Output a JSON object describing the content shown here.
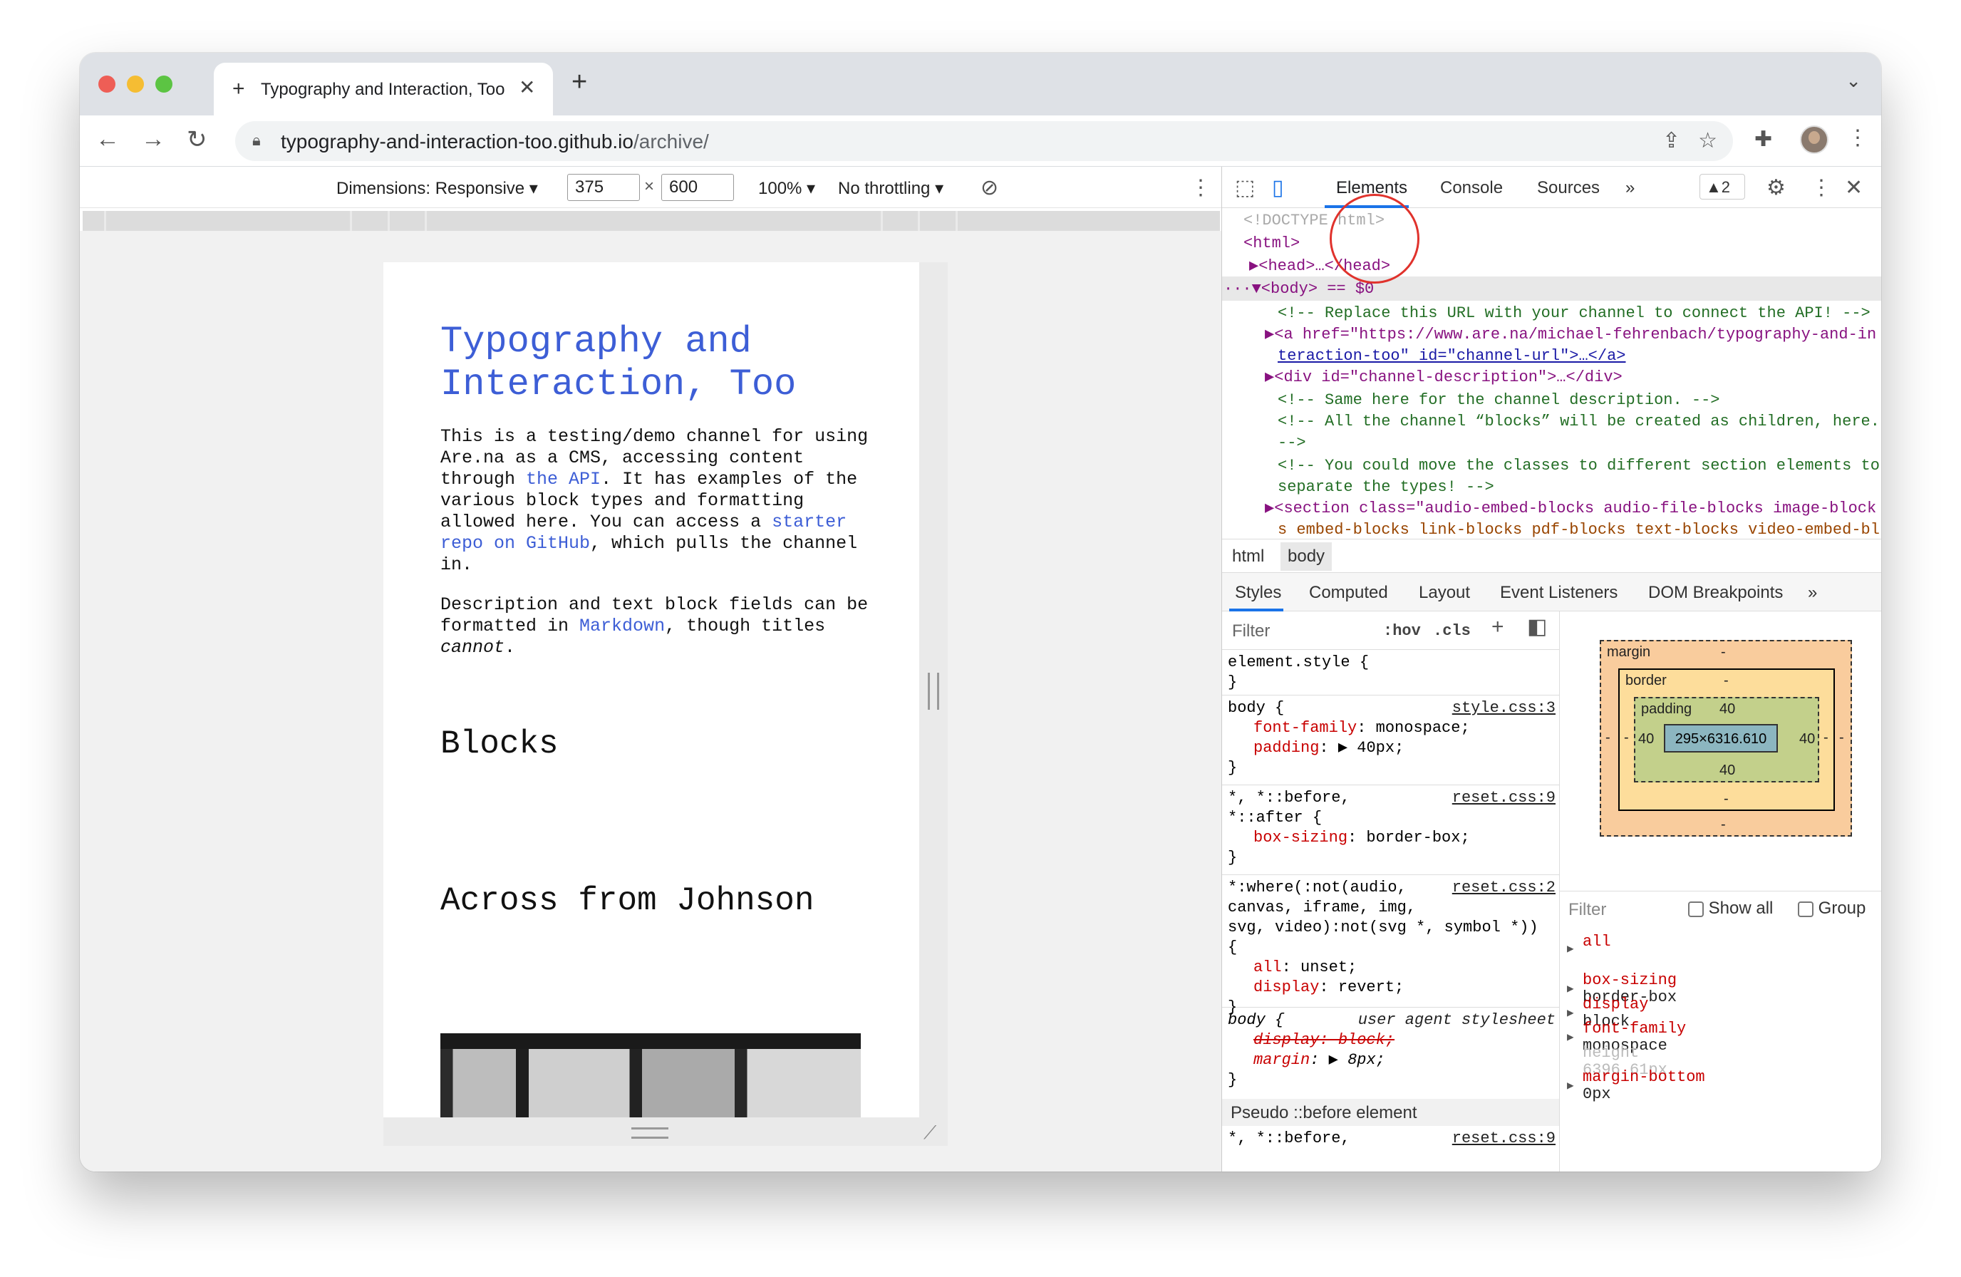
{
  "browser": {
    "tab_title": "Typography and Interaction, Too",
    "url_host": "typography-and-interaction-too.github.io",
    "url_path": "/archive/"
  },
  "device_toolbar": {
    "dimensions_label": "Dimensions: Responsive ▾",
    "width": "375",
    "height": "600",
    "times": "×",
    "zoom": "100% ▾",
    "throttling": "No throttling ▾"
  },
  "page": {
    "title": "Typography and Interaction, Too",
    "intro": [
      "This is a testing/demo channel for using Are.na as a CMS, accessing content through ",
      "the API",
      ". It has examples of the various block types and formatting allowed here. You can access a ",
      "starter repo on GitHub",
      ", which pulls the channel in."
    ],
    "desc": [
      "Description and text block fields can be formatted in ",
      "Markdown",
      ", though titles ",
      "cannot",
      "."
    ],
    "blocks_heading": "Blocks",
    "block_title": "Across from Johnson"
  },
  "devtools": {
    "tabs": [
      "Elements",
      "Console",
      "Sources",
      "»"
    ],
    "warnings": "▲2",
    "dom": [
      "<!DOCTYPE html>",
      "<html>",
      "▶<head>…</head>",
      "···▼<body> == $0",
      "<!-- Replace this URL with your channel to connect the API! -->",
      "▶<a href=\"https://www.are.na/michael-fehrenbach/typography-and-in",
      "teraction-too\" id=\"channel-url\">…</a>",
      "▶<div id=\"channel-description\">…</div>",
      "<!-- Same here for the channel description. -->",
      "<!-- All the channel “blocks” will be created as children, here.",
      "-->",
      "<!-- You could move the classes to different section elements to",
      "separate the types! -->",
      "▶<section class=\"audio-embed-blocks audio-file-blocks image-block",
      "s embed-blocks link-blocks pdf-blocks text-blocks video-embed-bl"
    ],
    "breadcrumbs": [
      "html",
      "body"
    ],
    "style_tabs": [
      "Styles",
      "Computed",
      "Layout",
      "Event Listeners",
      "DOM Breakpoints",
      "»"
    ],
    "filter_placeholder": "Filter",
    "hov": ":hov",
    "cls": ".cls",
    "rules": {
      "r1": [
        "element.style {",
        "}"
      ],
      "r2": {
        "sel": "body {",
        "src": "style.css:3",
        "l1p": "font-family",
        "l1v": ": monospace;",
        "l2p": "padding",
        "l2v": ": ▶ 40px;",
        "end": "}"
      },
      "r3": {
        "sel1": "*, *::before,",
        "sel2": "*::after {",
        "src": "reset.css:9",
        "p": "box-sizing",
        "v": ": border-box;",
        "end": "}"
      },
      "r4": {
        "sel1": "*:where(:not(audio,",
        "sel2": "canvas, iframe, img,",
        "sel3": "svg, video):not(svg *, symbol *))",
        "sel4": "{",
        "src": "reset.css:2",
        "p1": "all",
        "v1": ": unset;",
        "p2": "display",
        "v2": ": revert;",
        "end": "}"
      },
      "r5": {
        "sel": "body {",
        "src": "user agent stylesheet",
        "p1": "display: block;",
        "p2": "margin",
        "v2": ": ▶ 8px;",
        "end": "}"
      },
      "pseudo": "Pseudo ::before element",
      "r6": {
        "sel": "*, *::before,",
        "src": "reset.css:9"
      }
    },
    "box_model": {
      "margin_label": "margin",
      "margin": "-",
      "border_label": "border",
      "border": "-",
      "padding_label": "padding",
      "padding": "40",
      "content": "295×6316.610"
    },
    "computed": {
      "filter": "Filter",
      "show_all": "Show all",
      "group": "Group",
      "items": [
        {
          "name": "all",
          "value": ""
        },
        {
          "name": "box-sizing",
          "value": "border-box"
        },
        {
          "name": "display",
          "value": "block"
        },
        {
          "name": "font-family",
          "value": "monospace"
        },
        {
          "name": "height",
          "value": "6396.61px"
        },
        {
          "name": "margin-bottom",
          "value": "0px"
        }
      ]
    }
  }
}
